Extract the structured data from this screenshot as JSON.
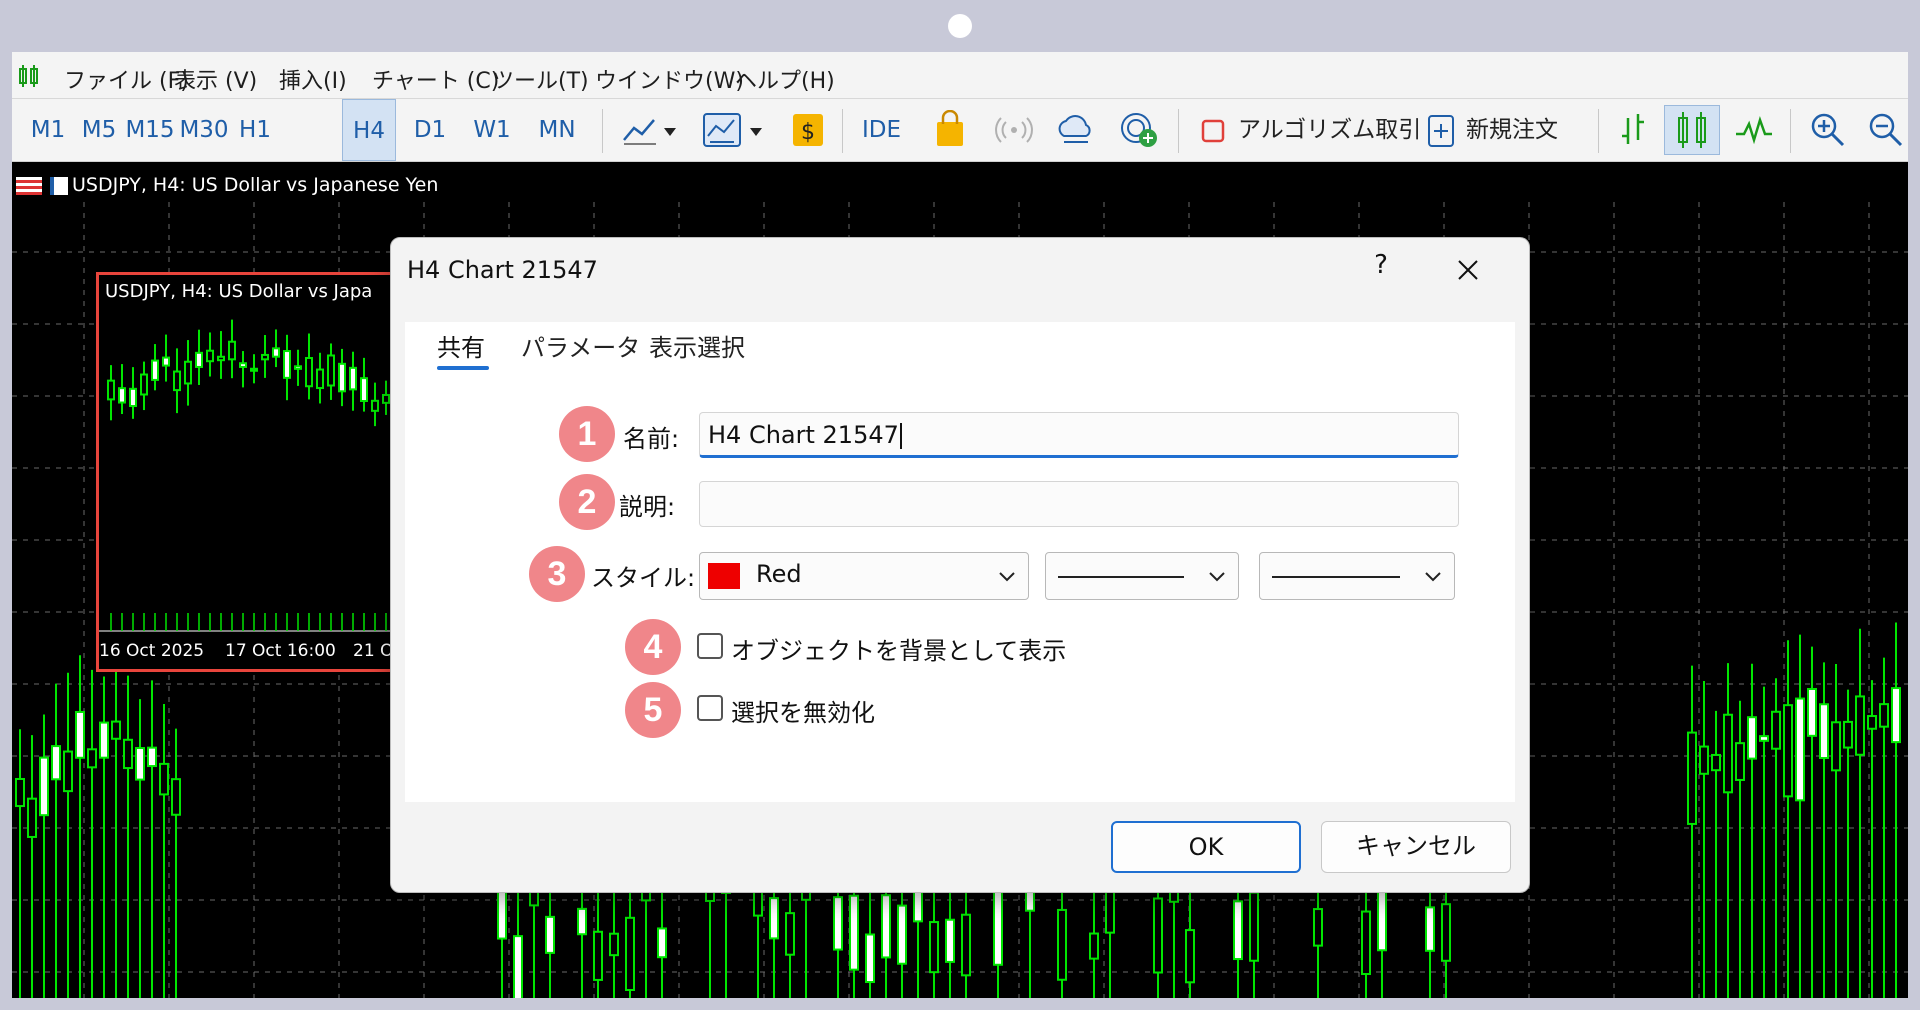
{
  "menubar": {
    "items": [
      "ファイル (F)",
      "表示 (V)",
      "挿入(I)",
      "チャート (C)",
      "ツール(T)",
      "ウインドウ(W)",
      "ヘルプ(H)"
    ]
  },
  "toolbar": {
    "timeframes": [
      "M1",
      "M5",
      "M15",
      "M30",
      "H1",
      "H4",
      "D1",
      "W1",
      "MN"
    ],
    "active_timeframe": "H4",
    "ide_label": "IDE",
    "algo_label": "アルゴリズム取引",
    "new_order_label": "新規注文",
    "icons": [
      "line-chart-icon",
      "chart-template-icon",
      "dollar-icon",
      "market-bag-icon",
      "signal-icon",
      "cloud-icon",
      "vps-icon",
      "zoom-in-icon",
      "zoom-out-icon"
    ]
  },
  "chart": {
    "header": "USDJPY, H4:  US Dollar vs Japanese Yen",
    "mini_header": "USDJPY, H4:  US Dollar vs Japa",
    "mini_ticks": [
      "16 Oct 2025",
      "17 Oct 16:00",
      "21 O"
    ],
    "colors": {
      "background": "#000000",
      "candle": "#00e600",
      "grid": "#6a6a6a",
      "highlight": "#e8453c"
    }
  },
  "dialog": {
    "title": "H4 Chart 21547",
    "help": "?",
    "close": "✕",
    "tabs": [
      "共有",
      "パラメータ",
      "表示選択"
    ],
    "active_tab": "共有",
    "fields": {
      "name_label": "名前:",
      "name_value": "H4 Chart 21547",
      "description_label": "説明:",
      "description_value": "",
      "style_label": "スタイル:",
      "color_value": "Red",
      "color_hex": "#ee0000"
    },
    "checkboxes": {
      "background_label": "オブジェクトを背景として表示",
      "background_checked": false,
      "disable_selection_label": "選択を無効化",
      "disable_selection_checked": false
    },
    "badges": [
      "1",
      "2",
      "3",
      "4",
      "5"
    ],
    "buttons": {
      "ok": "OK",
      "cancel": "キャンセル"
    }
  }
}
